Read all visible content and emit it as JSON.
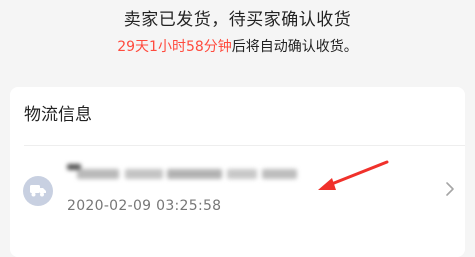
{
  "status": {
    "title": "卖家已发货，待买家确认收货",
    "countdown": "29天1小时58分钟",
    "suffix": "后将自动确认收货。"
  },
  "logistics": {
    "card_title": "物流信息",
    "timestamp": "2020-02-09 03:25:58"
  },
  "icons": {
    "avatar": "truck-icon",
    "chevron": "chevron-right-icon",
    "annotation": "red-arrow-icon"
  },
  "colors": {
    "countdown": "#ff4b3e",
    "annotation": "#f0312b",
    "avatar_bg": "#c8d0e1"
  }
}
